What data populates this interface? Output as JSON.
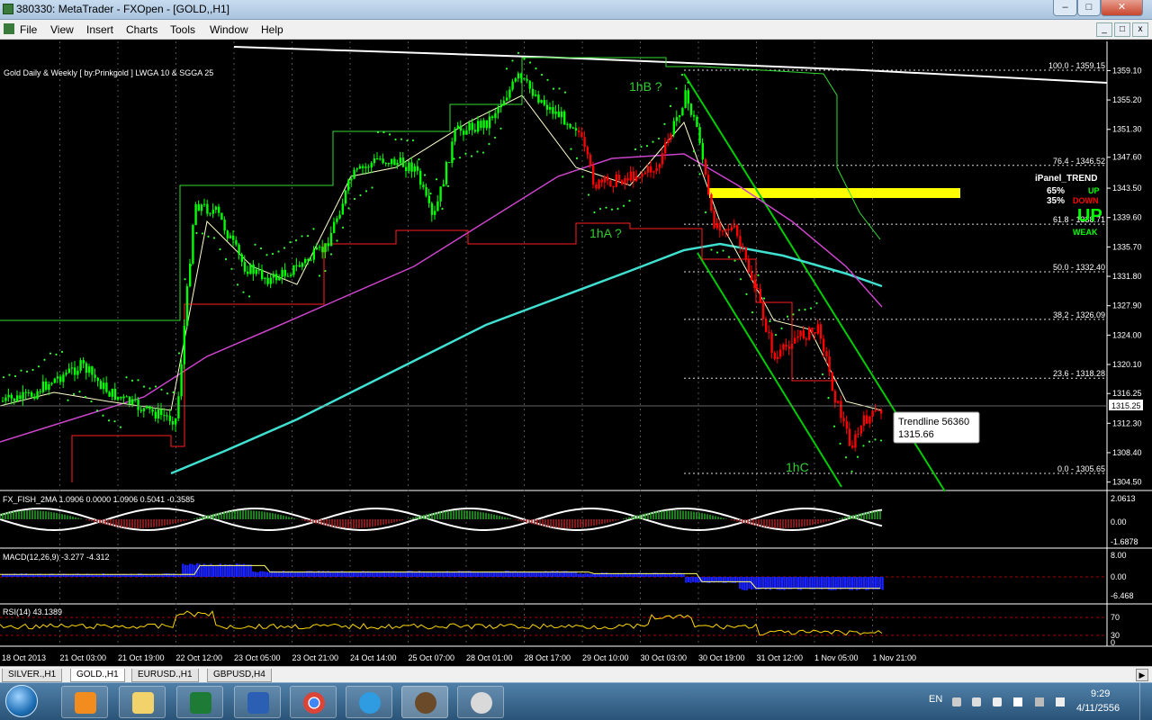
{
  "window": {
    "title": "380330: MetaTrader - FXOpen - [GOLD,,H1]"
  },
  "menu": [
    "File",
    "View",
    "Insert",
    "Charts",
    "Tools",
    "Window",
    "Help"
  ],
  "chart": {
    "header": "Gold Daily & Weekly [ by:Prinkgold ]  LWGA 10  &  SGGA 25",
    "wave_labels": {
      "a": "1hA ?",
      "b": "1hB ?",
      "c": "1hC"
    },
    "ipanel": {
      "title": "iPanel_TREND",
      "up_pct": "65%",
      "up_label": "UP",
      "down_pct": "35%",
      "down_label": "DOWN",
      "trend": "UP",
      "strength": "WEAK"
    },
    "fib_levels": [
      {
        "label": "100.0 - 1359.15",
        "price": 1359.15
      },
      {
        "label": "76.4 - 1346.52",
        "price": 1346.52
      },
      {
        "label": "61.8 - 1338.71",
        "price": 1338.71
      },
      {
        "label": "50.0 - 1332.40",
        "price": 1332.4
      },
      {
        "label": "38.2 - 1326.09",
        "price": 1326.09
      },
      {
        "label": "23.6 - 1318.28",
        "price": 1318.28
      },
      {
        "label": "0.0 - 1305.65",
        "price": 1305.65
      }
    ],
    "price_axis": [
      "1359.10",
      "1355.20",
      "1351.30",
      "1347.60",
      "1343.50",
      "1339.60",
      "1335.70",
      "1331.80",
      "1327.90",
      "1324.00",
      "1320.10",
      "1316.25",
      "1312.30",
      "1308.40",
      "1304.50"
    ],
    "current_price": "1315.25",
    "tooltip": {
      "line1": "Trendline 56360",
      "line2": "1315.66"
    },
    "time_axis": [
      "18 Oct 2013",
      "21 Oct 03:00",
      "21 Oct 19:00",
      "22 Oct 12:00",
      "23 Oct 05:00",
      "23 Oct 21:00",
      "24 Oct 14:00",
      "25 Oct 07:00",
      "28 Oct 01:00",
      "28 Oct 17:00",
      "29 Oct 10:00",
      "30 Oct 03:00",
      "30 Oct 19:00",
      "31 Oct 12:00",
      "1 Nov 05:00",
      "1 Nov 21:00"
    ]
  },
  "indicators": {
    "fisher": {
      "label": "FX_FISH_2MA 1.0906 0.0000 1.0906 0.5041 -0.3585",
      "axis": [
        "2.0613",
        "0.00",
        "-1.6878"
      ]
    },
    "macd": {
      "label": "MACD(12,26,9) -3.277 -4.312",
      "axis": [
        "8.00",
        "0.00",
        "-6.468"
      ]
    },
    "rsi": {
      "label": "RSI(14) 43.1389",
      "axis": [
        "70",
        "30",
        "0"
      ]
    }
  },
  "tabs": [
    "SILVER.,H1",
    "GOLD.,H1",
    "EURUSD.,H1",
    "GBPUSD,H4"
  ],
  "active_tab": 1,
  "taskbar": {
    "lang": "EN",
    "time": "9:29",
    "date": "4/11/2556"
  },
  "colors": {
    "bull": "#00ff00",
    "bear": "#ff0000",
    "fib": "#ffffff",
    "zone": "#ffff00",
    "ma_cyan": "#40e0d0",
    "ma_magenta": "#cc44cc"
  }
}
